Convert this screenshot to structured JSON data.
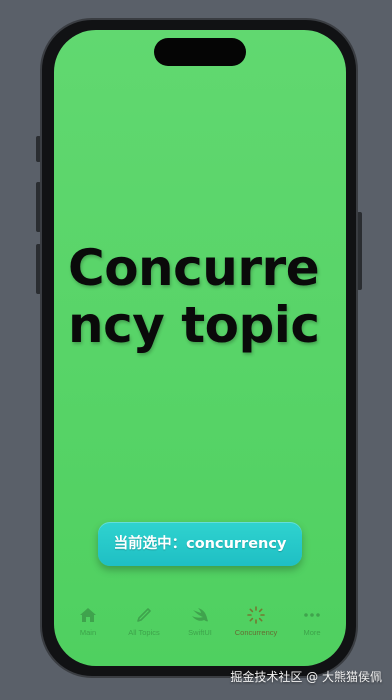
{
  "main": {
    "title": "Concurrency topic",
    "current_selection_label": "当前选中：concurrency"
  },
  "tab_bar": {
    "items": [
      {
        "label": "Main",
        "icon": "house-icon",
        "selected": false
      },
      {
        "label": "All Topics",
        "icon": "pencil-icon",
        "selected": false
      },
      {
        "label": "SwiftUI",
        "icon": "swift-bird-icon",
        "selected": false
      },
      {
        "label": "Concurrency",
        "icon": "progress-spinner-icon",
        "selected": true
      },
      {
        "label": "More",
        "icon": "ellipsis-icon",
        "selected": false
      }
    ]
  },
  "colors": {
    "background": "#5a6069",
    "screen": "#5ad46a",
    "button": "#28c9c9",
    "title_text": "#0a0a0a"
  },
  "watermark": "掘金技术社区 @ 大熊猫侯佩"
}
